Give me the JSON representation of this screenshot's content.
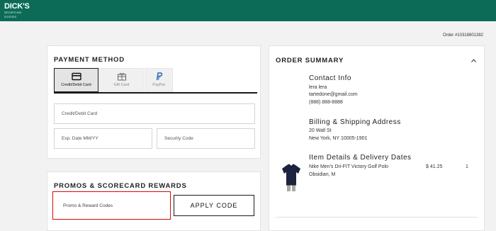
{
  "brand": {
    "logo_main": "DICK'S",
    "logo_sub": "SPORTING GOODS",
    "header_color": "#0b6b57"
  },
  "order_number": "Order #10318801382",
  "payment": {
    "title": "PAYMENT METHOD",
    "tabs": [
      {
        "label": "Credit/Debit Card",
        "icon": "credit-card-icon",
        "active": true
      },
      {
        "label": "Gift Card",
        "icon": "gift-card-icon",
        "active": false
      },
      {
        "label": "PayPal",
        "icon": "paypal-icon",
        "active": false
      }
    ],
    "card_placeholder": "Credit/Debit Card",
    "exp_placeholder": "Exp. Date MM/YY",
    "security_placeholder": "Security Code"
  },
  "promos": {
    "title": "PROMOS & SCORECARD REWARDS",
    "input_placeholder": "Promo & Reward Codes",
    "apply_label": "APPLY CODE",
    "highlight_color": "#d20a0a"
  },
  "summary": {
    "title": "ORDER SUMMARY",
    "contact": {
      "title": "Contact Info",
      "name": "lera lera",
      "email": "tartedone@gmail.com",
      "phone": "(888) 888-8888"
    },
    "address": {
      "title": "Billing & Shipping Address",
      "line1": "20 Wall St",
      "line2": "New York, NY 10005-1901"
    },
    "items": {
      "title": "Item Details & Delivery Dates",
      "product_name": "Nike Men's Dri-FIT Victory Golf Polo",
      "product_variant": "Obsidian, M",
      "price": "$ 41.25",
      "quantity": "1"
    }
  }
}
